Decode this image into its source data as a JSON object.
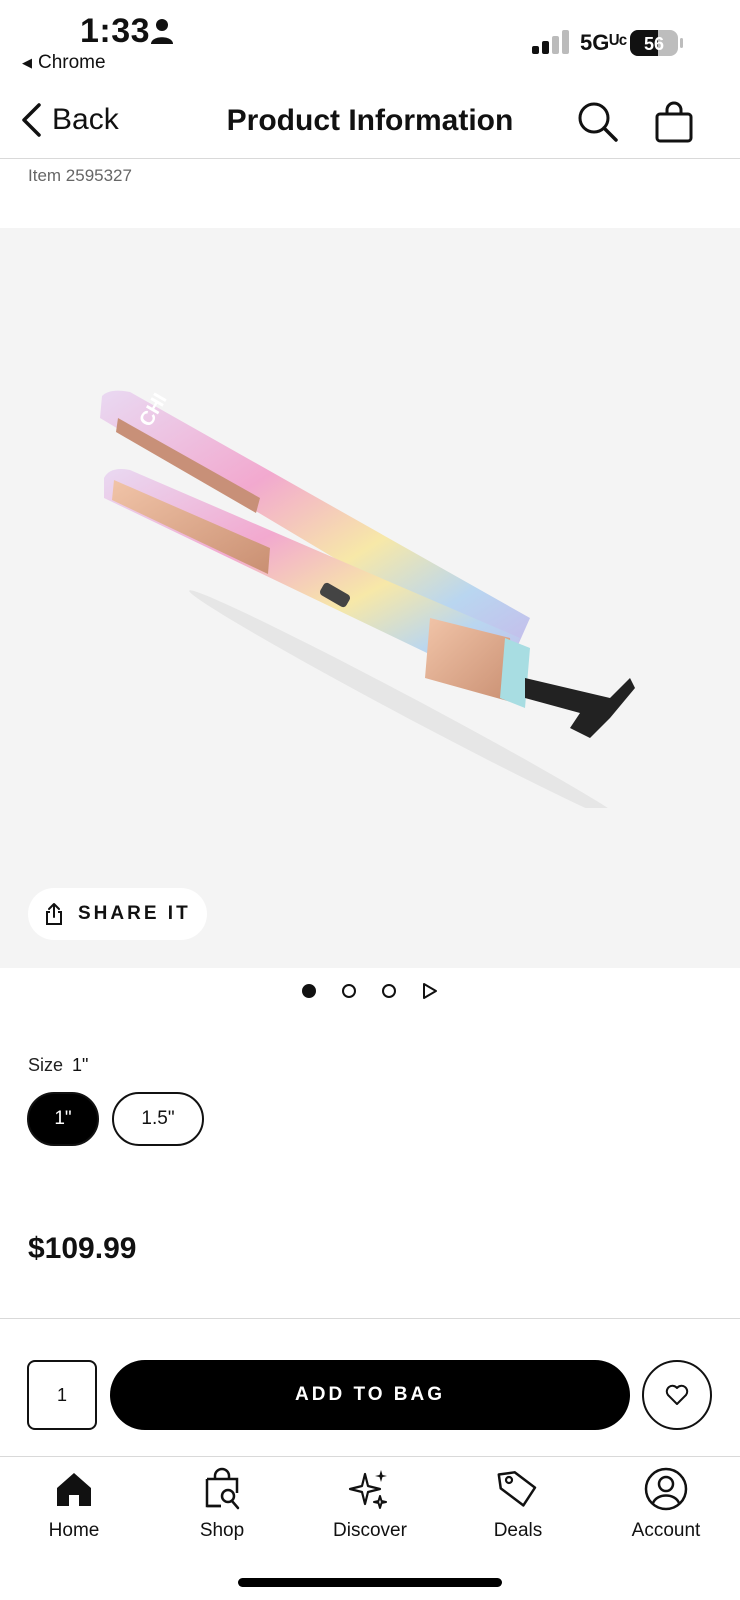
{
  "status_bar": {
    "time": "1:33",
    "back_app": "Chrome",
    "network": "5Gᵁᶜ",
    "battery": "56"
  },
  "header": {
    "back_label": "Back",
    "title": "Product Information"
  },
  "product": {
    "item_number": "Item 2595327",
    "share_label": "SHARE IT",
    "image_count": 3,
    "active_image_index": 0,
    "size_label": "Size",
    "selected_size": "1\"",
    "sizes": [
      "1\"",
      "1.5\""
    ],
    "price": "$109.99"
  },
  "purchase": {
    "quantity": "1",
    "add_label": "ADD TO BAG"
  },
  "tab_bar": {
    "items": [
      {
        "label": "Home",
        "icon": "home-icon"
      },
      {
        "label": "Shop",
        "icon": "shopping-bag-search-icon"
      },
      {
        "label": "Discover",
        "icon": "sparkle-icon"
      },
      {
        "label": "Deals",
        "icon": "tag-icon"
      },
      {
        "label": "Account",
        "icon": "account-icon"
      }
    ]
  },
  "colors": {
    "accent": "#000000",
    "gallery_bg": "#f4f4f4"
  }
}
